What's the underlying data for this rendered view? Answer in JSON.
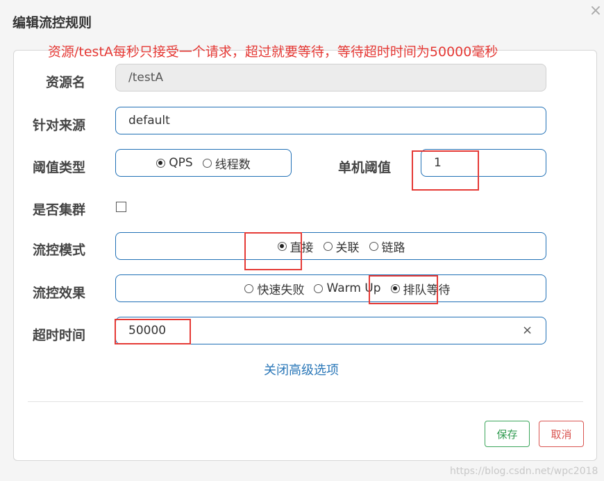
{
  "dialog": {
    "title": "编辑流控规则",
    "close_glyph": "×"
  },
  "annotation": "资源/testA每秒只接受一个请求，超过就要等待，等待超时时间为50000毫秒",
  "form": {
    "resource": {
      "label": "资源名",
      "value": "/testA"
    },
    "origin": {
      "label": "针对来源",
      "value": "default"
    },
    "threshold_type": {
      "label": "阈值类型",
      "options": [
        "QPS",
        "线程数"
      ],
      "selected": "QPS"
    },
    "single_threshold": {
      "label": "单机阈值",
      "value": "1"
    },
    "cluster": {
      "label": "是否集群",
      "checked": false
    },
    "flow_mode": {
      "label": "流控模式",
      "options": [
        "直接",
        "关联",
        "链路"
      ],
      "selected": "直接"
    },
    "flow_effect": {
      "label": "流控效果",
      "options": [
        "快速失败",
        "Warm Up",
        "排队等待"
      ],
      "selected": "排队等待"
    },
    "timeout": {
      "label": "超时时间",
      "value": "50000",
      "clear_glyph": "×"
    },
    "advanced_link": "关闭高级选项"
  },
  "buttons": {
    "save": "保存",
    "cancel": "取消"
  },
  "watermark": "https://blog.csdn.net/wpc2018",
  "colors": {
    "accent": "#1f6fb5",
    "annotation": "#e53935",
    "save": "#2e9a4f",
    "cancel": "#d9534f"
  }
}
